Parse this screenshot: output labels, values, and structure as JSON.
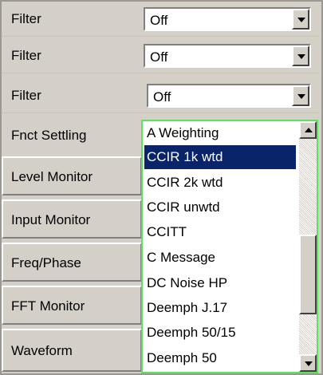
{
  "rows": [
    {
      "label": "Filter",
      "value": "Off"
    },
    {
      "label": "Filter",
      "value": "Off"
    },
    {
      "label": "Filter",
      "value": "Off"
    }
  ],
  "settling_label": "Fnct Settling",
  "buttons": [
    {
      "label": "Level Monitor"
    },
    {
      "label": "Input Monitor"
    },
    {
      "label": "Freq/Phase"
    },
    {
      "label": "FFT Monitor"
    },
    {
      "label": "Waveform"
    }
  ],
  "dropdown": {
    "selected": "CCIR 1k wtd",
    "options": [
      "A Weighting",
      "CCIR 1k wtd",
      "CCIR 2k wtd",
      "CCIR unwtd",
      "CCITT",
      "C Message",
      "DC Noise HP",
      "Deemph J.17",
      "Deemph 50/15",
      "Deemph 50"
    ]
  },
  "colors": {
    "panel": "#d4d0c8",
    "selection": "#0a246a",
    "focus_border": "#5be35b"
  }
}
